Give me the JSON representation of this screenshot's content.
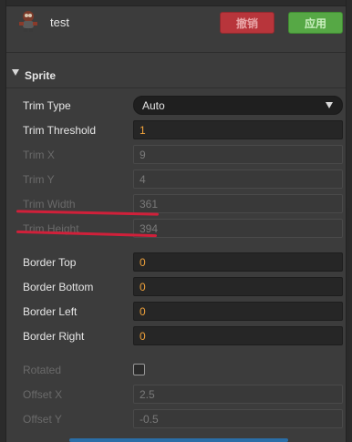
{
  "header": {
    "asset_name": "test",
    "revert_label": "撤销",
    "apply_label": "应用"
  },
  "section": {
    "title": "Sprite"
  },
  "fields": {
    "trim_type": {
      "label": "Trim Type",
      "value": "Auto"
    },
    "trim_threshold": {
      "label": "Trim Threshold",
      "value": "1"
    },
    "trim_x": {
      "label": "Trim X",
      "value": "9"
    },
    "trim_y": {
      "label": "Trim Y",
      "value": "4"
    },
    "trim_width": {
      "label": "Trim Width",
      "value": "361"
    },
    "trim_height": {
      "label": "Trim Height",
      "value": "394"
    },
    "border_top": {
      "label": "Border Top",
      "value": "0"
    },
    "border_bottom": {
      "label": "Border Bottom",
      "value": "0"
    },
    "border_left": {
      "label": "Border Left",
      "value": "0"
    },
    "border_right": {
      "label": "Border Right",
      "value": "0"
    },
    "rotated": {
      "label": "Rotated",
      "checked": false
    },
    "offset_x": {
      "label": "Offset X",
      "value": "2.5"
    },
    "offset_y": {
      "label": "Offset Y",
      "value": "-0.5"
    }
  },
  "colors": {
    "value_orange": "#f0a23b",
    "underline_red": "#d0203a",
    "revert_red": "#b8353b",
    "apply_green": "#56a845"
  },
  "icons": [
    "sprite-thumbnail-icon",
    "collapse-arrow-icon",
    "dropdown-caret-icon"
  ]
}
